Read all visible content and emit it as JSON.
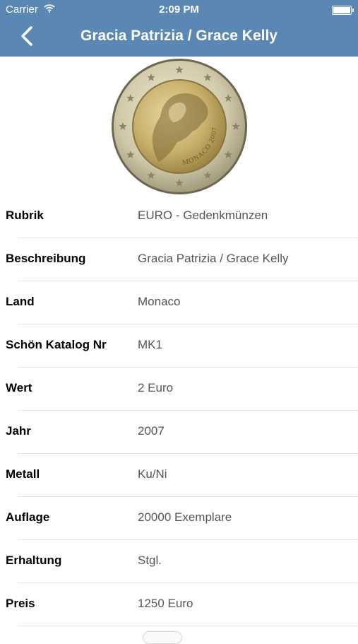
{
  "status_bar": {
    "carrier": "Carrier",
    "time": "2:09 PM"
  },
  "nav": {
    "title": "Gracia Patrizia / Grace Kelly",
    "back_icon": "chevron-left-icon"
  },
  "coin": {
    "inscription": "MONACO 2007"
  },
  "details": [
    {
      "label": "Rubrik",
      "value": "EURO - Gedenkmünzen"
    },
    {
      "label": "Beschreibung",
      "value": "Gracia Patrizia / Grace Kelly"
    },
    {
      "label": "Land",
      "value": "Monaco"
    },
    {
      "label": "Schön Katalog Nr",
      "value": "MK1"
    },
    {
      "label": "Wert",
      "value": "2 Euro"
    },
    {
      "label": "Jahr",
      "value": "2007"
    },
    {
      "label": "Metall",
      "value": "Ku/Ni"
    },
    {
      "label": "Auflage",
      "value": "20000 Exemplare"
    },
    {
      "label": "Erhaltung",
      "value": "Stgl."
    },
    {
      "label": "Preis",
      "value": "1250 Euro"
    }
  ],
  "colors": {
    "nav_bar": "#5a87b3",
    "label": "#000000",
    "value": "#555555",
    "separator": "#e3e3e3"
  }
}
